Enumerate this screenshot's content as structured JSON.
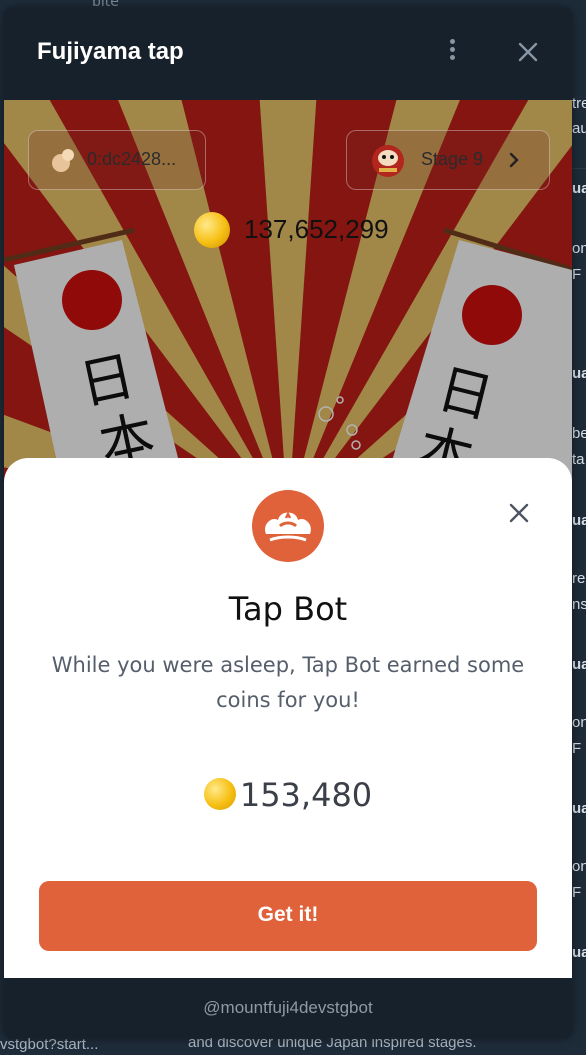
{
  "window": {
    "title": "Fujiyama tap"
  },
  "game": {
    "wallet_label": "0:dc2428...",
    "stage_label": "Stage 9",
    "balance": "137,652,299"
  },
  "modal": {
    "title": "Tap Bot",
    "description": "While you were asleep, Tap Bot earned some coins for you!",
    "reward": "153,480",
    "button_label": "Get it!",
    "accent_color": "#e0623a"
  },
  "footer": {
    "bot_handle": "@mountfuji4devstgbot"
  },
  "background": {
    "top_text": "bite",
    "bottom_left_text": "vstgbot?start...",
    "bottom_text": "and discover unique Japan inspired stages."
  }
}
